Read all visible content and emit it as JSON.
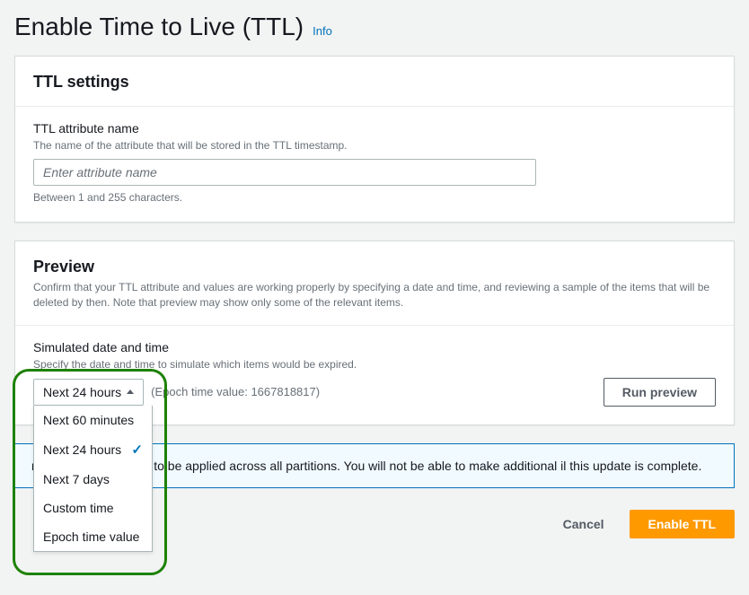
{
  "header": {
    "title": "Enable Time to Live (TTL)",
    "info_link": "Info"
  },
  "ttl_settings": {
    "title": "TTL settings",
    "attr_label": "TTL attribute name",
    "attr_desc": "The name of the attribute that will be stored in the TTL timestamp.",
    "attr_placeholder": "Enter attribute name",
    "attr_value": "",
    "attr_constraint": "Between 1 and 255 characters."
  },
  "preview": {
    "title": "Preview",
    "desc": "Confirm that your TTL attribute and values are working properly by specifying a date and time, and reviewing a sample of the items that will be deleted by then. Note that preview may show only some of the relevant items.",
    "sim_label": "Simulated date and time",
    "sim_desc": "Specify the date and time to simulate which items would be expired.",
    "selected_option": "Next 24 hours",
    "epoch_note": "(Epoch time value: 1667818817)",
    "run_button": "Run preview",
    "options": [
      "Next 60 minutes",
      "Next 24 hours",
      "Next 7 days",
      "Custom time",
      "Epoch time value"
    ],
    "selected_index": 1
  },
  "banner": {
    "text_visible": "n take up to one hour to be applied across all partitions. You will not be able to make additional il this update is complete."
  },
  "footer": {
    "cancel": "Cancel",
    "submit": "Enable TTL"
  }
}
